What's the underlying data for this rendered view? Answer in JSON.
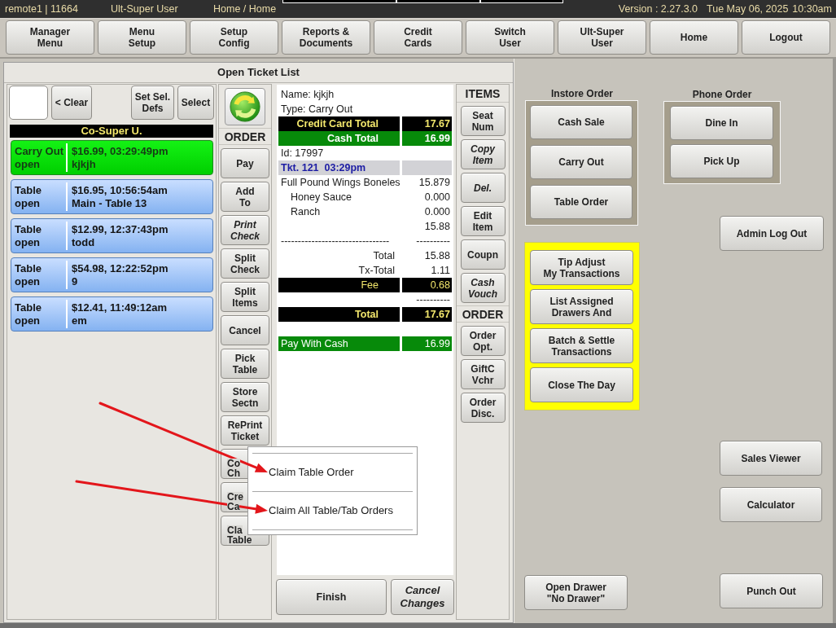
{
  "status_bar": {
    "station": "remote1 | 11664",
    "user": "Ult-Super User",
    "location": "Home / Home",
    "version": "Version : 2.27.3.0",
    "date": "Tue May 06, 2025",
    "time": "10:30am"
  },
  "menu_bar": [
    "Manager\nMenu",
    "Menu\nSetup",
    "Setup\nConfig",
    "Reports &\nDocuments",
    "Credit\nCards",
    "Switch\nUser",
    "Ult-Super\nUser",
    "Home",
    "Logout"
  ],
  "ticket_list": {
    "title": "Open Ticket List",
    "toolbar": [
      "< Clear",
      "Set Sel.\nDefs",
      "Select"
    ],
    "group": "Co-Super U.",
    "tickets": [
      {
        "type": "Carry Out",
        "status": "open",
        "summary": "$16.99, 03:29:49pm",
        "name": "kjkjh",
        "selected": true
      },
      {
        "type": "Table",
        "status": "open",
        "summary": "$16.95, 10:56:54am",
        "name": "Main - Table 13",
        "selected": false
      },
      {
        "type": "Table",
        "status": "open",
        "summary": "$12.99, 12:37:43pm",
        "name": "todd",
        "selected": false
      },
      {
        "type": "Table",
        "status": "open",
        "summary": "$54.98, 12:22:52pm",
        "name": "9",
        "selected": false
      },
      {
        "type": "Table",
        "status": "open",
        "summary": "$12.41, 11:49:12am",
        "name": "em",
        "selected": false
      }
    ]
  },
  "order_column": {
    "header": "ORDER",
    "buttons": [
      {
        "label": "Pay",
        "italic": false
      },
      {
        "label": "Add\nTo",
        "italic": false
      },
      {
        "label": "Print\nCheck",
        "italic": true
      },
      {
        "label": "Split\nCheck",
        "italic": false
      },
      {
        "label": "Split\nItems",
        "italic": false
      },
      {
        "label": "Cancel",
        "italic": false
      },
      {
        "label": "Pick\nTable",
        "italic": false
      },
      {
        "label": "Store\nSectn",
        "italic": false
      },
      {
        "label": "RePrint\nTicket",
        "italic": false
      },
      {
        "label": "Co\nCh",
        "italic": false
      },
      {
        "label": "Cre\nCa",
        "italic": false
      },
      {
        "label": "Cla\nTable",
        "italic": false
      }
    ]
  },
  "receipt": {
    "lines": [
      {
        "kind": "info",
        "text": "Name: kjkjh"
      },
      {
        "kind": "info",
        "text": "Type: Carry Out"
      },
      {
        "kind": "banner",
        "label": "Credit Card Total",
        "value": "17.67"
      },
      {
        "kind": "cash",
        "label": "Cash Total",
        "value": "16.99"
      },
      {
        "kind": "info",
        "text": "Id: 17997"
      },
      {
        "kind": "ticket",
        "label": "Tkt. 121  03:29pm"
      },
      {
        "kind": "item",
        "label": "Full Pound Wings Boneles",
        "value": "15.879"
      },
      {
        "kind": "modifier",
        "label": "Honey Sauce",
        "value": "0.000"
      },
      {
        "kind": "modifier",
        "label": "Ranch",
        "value": "0.000"
      },
      {
        "kind": "item",
        "value": "15.88"
      },
      {
        "kind": "item",
        "label": "--------------------------------",
        "value": "----------"
      },
      {
        "kind": "subtotal",
        "label": "Total",
        "value": "15.88"
      },
      {
        "kind": "subtotal",
        "label": "Tx-Total",
        "value": "1.11"
      },
      {
        "kind": "fee",
        "label": "Fee",
        "value": "0.68"
      },
      {
        "kind": "item",
        "value": "----------"
      },
      {
        "kind": "banner",
        "label": "Total",
        "value": "17.67"
      },
      {
        "kind": "pay",
        "label": "Pay With Cash",
        "value": "16.99"
      }
    ]
  },
  "items_column": {
    "header": "ITEMS",
    "buttons": [
      {
        "label": "Seat\nNum",
        "italic": false
      },
      {
        "label": "Copy\nItem",
        "italic": true
      },
      {
        "label": "Del.",
        "italic": true
      },
      {
        "label": "Edit\nItem",
        "italic": false
      },
      {
        "label": "Coupn",
        "italic": false
      },
      {
        "label": "Cash\nVouch",
        "italic": true
      }
    ],
    "order_header": "ORDER",
    "order_buttons": [
      {
        "label": "Order\nOpt.",
        "italic": false
      },
      {
        "label": "GiftC\nVchr",
        "italic": false
      },
      {
        "label": "Order\nDisc.",
        "italic": false
      }
    ]
  },
  "footer_buttons": [
    {
      "label": "Finish",
      "italic": false
    },
    {
      "label": "Cancel\nChanges",
      "italic": true
    }
  ],
  "context_menu": {
    "items": [
      {
        "label": "Claim Table Order",
        "arrow": true
      },
      {
        "label": "Claim All Table/Tab Orders",
        "arrow": true
      }
    ]
  },
  "home": {
    "instore": {
      "title": "Instore Order",
      "buttons": [
        "Cash Sale",
        "Carry Out",
        "Table Order"
      ]
    },
    "phone": {
      "title": "Phone Order",
      "buttons": [
        "Dine In",
        "Pick Up"
      ]
    },
    "admin_logout": "Admin Log Out",
    "manager_tasks": [
      "Tip Adjust\nMy Transactions",
      "List Assigned\nDrawers And",
      "Batch & Settle\nTransactions",
      "Close The Day"
    ],
    "sales_viewer": "Sales Viewer",
    "calculator": "Calculator",
    "open_drawer": "Open Drawer\n\"No Drawer\"",
    "punch_out": "Punch Out"
  }
}
